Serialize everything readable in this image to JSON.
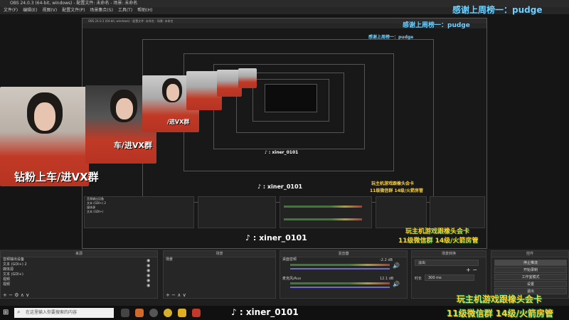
{
  "window": {
    "title": "OBS 24.0.3 (64-bit, windows) - 配置文件: 未命名 - 场景: 未命名"
  },
  "menu": [
    "文件(F)",
    "编辑(E)",
    "视图(V)",
    "配置文件(P)",
    "场景集合(S)",
    "工具(T)",
    "帮助(H)"
  ],
  "overlays": {
    "top_right": "感谢上周榜一：pudge",
    "inner_top": "感谢上周榜一：pudge",
    "inner_top2": "感谢上周榜一：pudge",
    "webcam_caption": "钻粉上车/进VX群",
    "webcam_caption2": "车/进VX群",
    "webcam_caption3": "/进VX群",
    "bottom_right_1": "玩主机游戏跟橡头会卡",
    "bottom_right_2": "11级微信群 14级/火箭房管",
    "tiktok_id": "xiner_0101"
  },
  "panels": {
    "sources": {
      "title": "来源",
      "items": [
        "音频输出设备",
        "文本 (GDI+) 2",
        "媒体源",
        "文本 (GDI+)",
        "视频",
        "视频"
      ]
    },
    "scenes": {
      "title": "场景",
      "items": [
        "场景"
      ]
    },
    "mixer": {
      "title": "混音器",
      "channels": [
        {
          "name": "桌面音频",
          "db": "-2.2 dB"
        },
        {
          "name": "麦克风/Aux",
          "db": "12.1 dB"
        }
      ]
    },
    "transitions": {
      "title": "场景转换",
      "fade_value": "淡出",
      "duration_label": "时长",
      "duration_value": "300 ms"
    },
    "controls": {
      "title": "控件",
      "buttons": [
        "停止推流",
        "开始录制",
        "工作室模式",
        "设置",
        "退出"
      ]
    }
  },
  "taskbar": {
    "search_placeholder": "在这里输入你要搜索的内容"
  }
}
